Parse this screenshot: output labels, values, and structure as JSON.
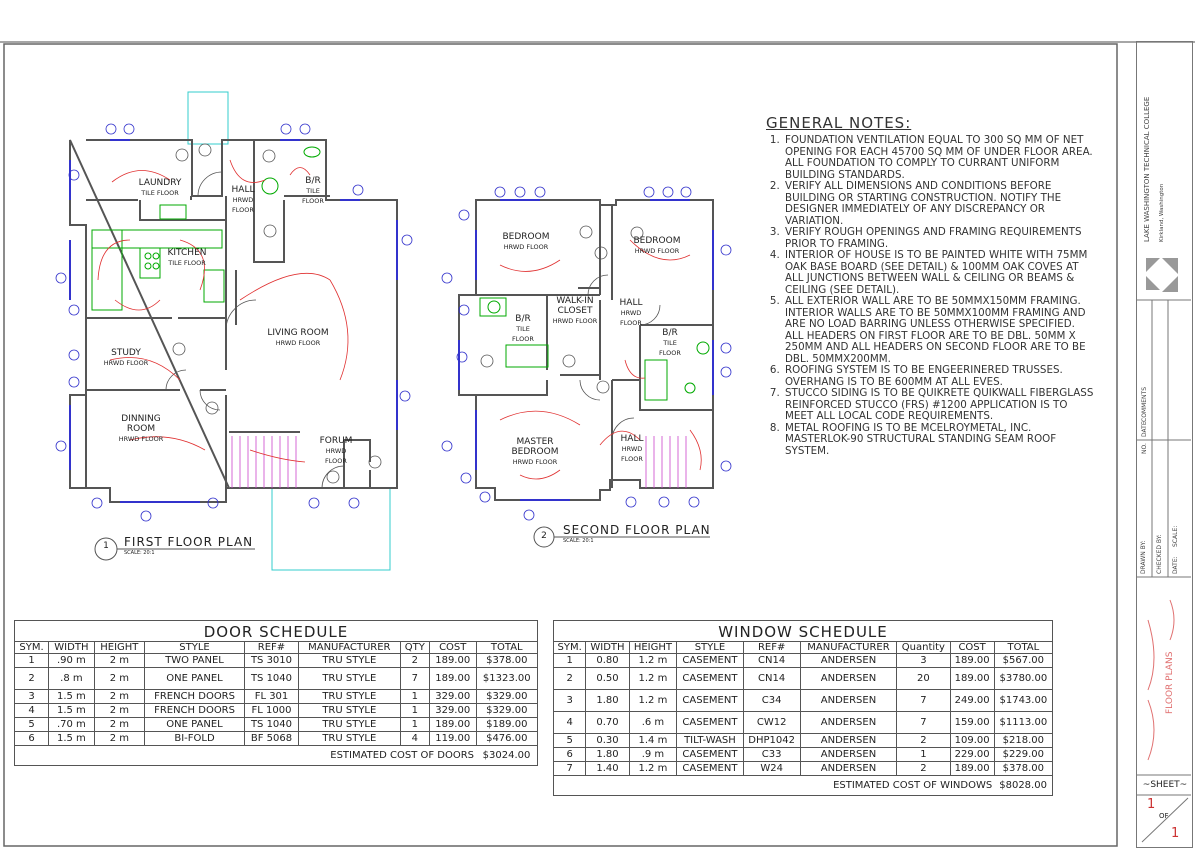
{
  "first_floor": {
    "title_number": "1",
    "title": "FIRST FLOOR PLAN",
    "scale": "SCALE:   20:1",
    "rooms": [
      {
        "name": "LAUNDRY",
        "floor": "TILE FLOOR"
      },
      {
        "name": "HALL",
        "floor": "HRWD FLOOR"
      },
      {
        "name": "B/R",
        "floor": "TILE FLOOR"
      },
      {
        "name": "KITCHEN",
        "floor": "TILE FLOOR"
      },
      {
        "name": "LIVING ROOM",
        "floor": "HRWD FLOOR"
      },
      {
        "name": "STUDY",
        "floor": "HRWD FLOOR"
      },
      {
        "name": "DINNING ROOM",
        "floor": "HRWD FLOOR"
      },
      {
        "name": "FORUM",
        "floor": "HRWD FLOOR"
      }
    ]
  },
  "second_floor": {
    "title_number": "2",
    "title": "SECOND FLOOR PLAN",
    "scale": "SCALE:   20:1",
    "rooms": [
      {
        "name": "BEDROOM",
        "floor": "HRWD FLOOR"
      },
      {
        "name": "BEDROOM",
        "floor": "HRWD FLOOR"
      },
      {
        "name": "WALK-IN CLOSET",
        "floor": "HRWD FLOOR"
      },
      {
        "name": "HALL",
        "floor": "HRWD FLOOR"
      },
      {
        "name": "B/R",
        "floor": "TILE FLOOR"
      },
      {
        "name": "B/R",
        "floor": "TILE FLOOR"
      },
      {
        "name": "MASTER BEDROOM",
        "floor": "HRWD FLOOR"
      },
      {
        "name": "HALL",
        "floor": "HRWD FLOOR"
      }
    ]
  },
  "general_notes": {
    "title": "GENERAL NOTES:",
    "items": [
      "FOUNDATION VENTILATION EQUAL TO 300 SQ MM OF NET OPENING FOR EACH 45700 SQ MM OF UNDER FLOOR AREA. ALL FOUNDATION TO COMPLY TO CURRANT UNIFORM BUILDING STANDARDS.",
      "VERIFY ALL DIMENSIONS AND CONDITIONS BEFORE BUILDING OR STARTING CONSTRUCTION. NOTIFY THE DESIGNER IMMEDIATELY OF ANY DISCREPANCY OR VARIATION.",
      "VERIFY ROUGH OPENINGS AND FRAMING REQUIREMENTS PRIOR TO FRAMING.",
      "INTERIOR OF HOUSE IS TO BE PAINTED WHITE WITH 75MM OAK  BASE BOARD (SEE DETAIL) & 100MM OAK COVES AT ALL JUNCTIONS BETWEEN WALL & CEILING OR BEAMS & CEILING (SEE DETAIL).",
      "ALL EXTERIOR WALL ARE TO BE 50MMX150MM FRAMING. INTERIOR WALLS ARE TO BE 50MMX100MM FRAMING AND ARE NO LOAD BARRING UNLESS OTHERWISE SPECIFIED. ALL HEADERS ON FIRST FLOOR ARE TO BE DBL. 50MM X 250MM AND ALL HEADERS ON SECOND FLOOR ARE TO BE DBL. 50MMX200MM.",
      "ROOFING SYSTEM IS TO BE ENGEERINERED TRUSSES. OVERHANG IS TO BE 600MM AT ALL EVES.",
      "STUCCO SIDING IS TO BE QUIKRETE QUIKWALL FIBERGLASS REINFORCED STUCCO (FRS) #1200 APPLICATION IS TO MEET ALL LOCAL CODE REQUIREMENTS.",
      "METAL ROOFING IS TO BE MCELROYMETAL, INC. MASTERLOK-90 STRUCTURAL STANDING SEAM ROOF SYSTEM."
    ]
  },
  "door_schedule": {
    "title": "DOOR SCHEDULE",
    "headers": [
      "SYM.",
      "WIDTH",
      "HEIGHT",
      "STYLE",
      "REF#",
      "MANUFACTURER",
      "QTY",
      "COST",
      "TOTAL"
    ],
    "rows": [
      [
        "1",
        ".90 m",
        "2 m",
        "TWO PANEL",
        "TS 3010",
        "TRU STYLE",
        "2",
        "189.00",
        "$378.00"
      ],
      [
        "2",
        ".8 m",
        "2 m",
        "ONE PANEL",
        "TS 1040",
        "TRU STYLE",
        "7",
        "189.00",
        "$1323.00"
      ],
      [
        "3",
        "1.5 m",
        "2 m",
        "FRENCH DOORS",
        "FL 301",
        "TRU STYLE",
        "1",
        "329.00",
        "$329.00"
      ],
      [
        "4",
        "1.5 m",
        "2 m",
        "FRENCH DOORS",
        "FL 1000",
        "TRU STYLE",
        "1",
        "329.00",
        "$329.00"
      ],
      [
        "5",
        ".70 m",
        "2 m",
        "ONE PANEL",
        "TS 1040",
        "TRU STYLE",
        "1",
        "189.00",
        "$189.00"
      ],
      [
        "6",
        "1.5 m",
        "2 m",
        "BI-FOLD",
        "BF 5068",
        "TRU STYLE",
        "4",
        "119.00",
        "$476.00"
      ]
    ],
    "estimate_label": "ESTIMATED COST OF DOORS",
    "estimate_value": "$3024.00"
  },
  "window_schedule": {
    "title": "WINDOW SCHEDULE",
    "headers": [
      "SYM.",
      "WIDTH",
      "HEIGHT",
      "STYLE",
      "REF#",
      "MANUFACTURER",
      "Quantity",
      "COST",
      "TOTAL"
    ],
    "rows": [
      [
        "1",
        "0.80",
        "1.2 m",
        "CASEMENT",
        "CN14",
        "ANDERSEN",
        "3",
        "189.00",
        "$567.00"
      ],
      [
        "2",
        "0.50",
        "1.2 m",
        "CASEMENT",
        "CN14",
        "ANDERSEN",
        "20",
        "189.00",
        "$3780.00"
      ],
      [
        "3",
        "1.80",
        "1.2 m",
        "CASEMENT",
        "C34",
        "ANDERSEN",
        "7",
        "249.00",
        "$1743.00"
      ],
      [
        "4",
        "0.70",
        ".6 m",
        "CASEMENT",
        "CW12",
        "ANDERSEN",
        "7",
        "159.00",
        "$1113.00"
      ],
      [
        "5",
        "0.30",
        "1.4 m",
        "TILT-WASH",
        "DHP1042",
        "ANDERSEN",
        "2",
        "109.00",
        "$218.00"
      ],
      [
        "6",
        "1.80",
        ".9 m",
        "CASEMENT",
        "C33",
        "ANDERSEN",
        "1",
        "229.00",
        "$229.00"
      ],
      [
        "7",
        "1.40",
        "1.2 m",
        "CASEMENT",
        "W24",
        "ANDERSEN",
        "2",
        "189.00",
        "$378.00"
      ]
    ],
    "estimate_label": "ESTIMATED COST OF WINDOWS",
    "estimate_value": "$8028.00"
  },
  "title_block": {
    "school": "LAKE WASHINGTON TECHNICAL COLLEGE",
    "location": "Kirkland, Washington",
    "comments": "COMMENTS",
    "date": "DATE",
    "no": "NO.",
    "drawn_by": "DRAWN BY:",
    "checked_by": "CHECKED BY:",
    "date_label": "DATE:",
    "scale_label": "SCALE:",
    "sheet_title": "FLOOR PLANS",
    "sheet": "~SHEET~",
    "sheet_num": "1",
    "of": "OF",
    "sheet_total": "1"
  },
  "colors": {
    "wall": "#555555",
    "window": "#3333cc",
    "electrical": "#e03030",
    "fixture": "#00aa00",
    "stair": "#cc44cc",
    "porch": "#33cccc",
    "annotation": "#3333cc"
  }
}
